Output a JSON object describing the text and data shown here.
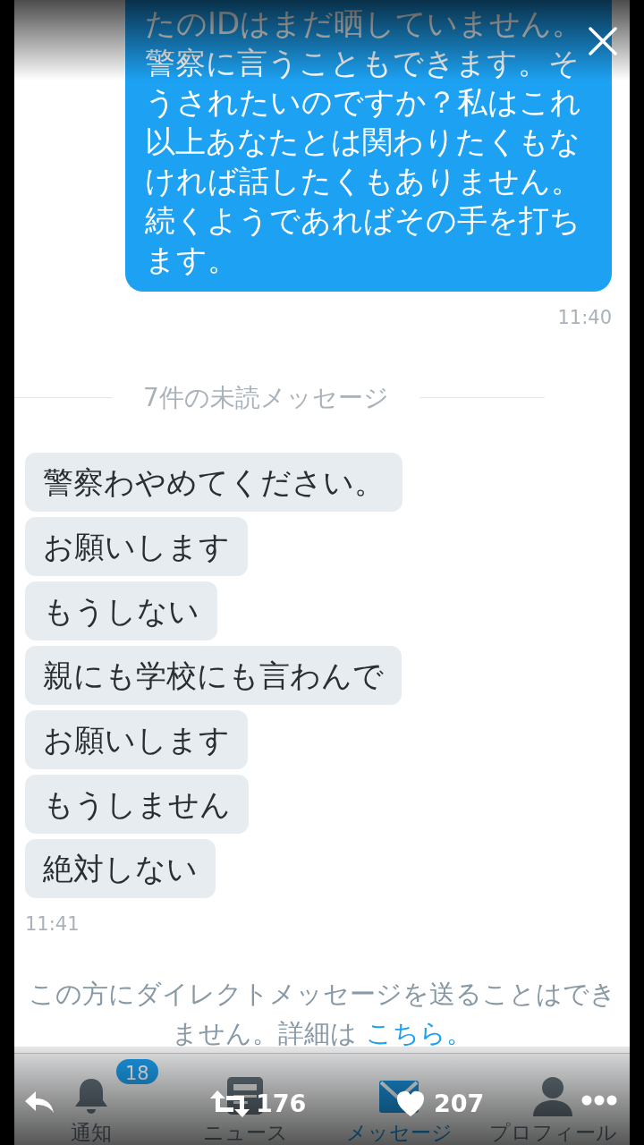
{
  "sent_message": {
    "text": "たのIDはまだ晒していません。警察に言うこともできます。そうされたいのですか？私はこれ以上あなたとは関わりたくもなければ話したくもありません。続くようであればその手を打ちます。",
    "time": "11:40"
  },
  "unread_divider": "7件の未読メッセージ",
  "received_messages": [
    {
      "text": "警察わやめてください。"
    },
    {
      "text": "お願いします"
    },
    {
      "text": "もうしない"
    },
    {
      "text": "親にも学校にも言わんで"
    },
    {
      "text": "お願いします"
    },
    {
      "text": "もうしません"
    },
    {
      "text": "絶対しない"
    }
  ],
  "received_time": "11:41",
  "notice": {
    "text": "この方にダイレクトメッセージを送ることはできません。詳細は",
    "link": "こちら。"
  },
  "tab_bar": [
    {
      "kind": "bell",
      "label": "通知",
      "badge": "18",
      "selected": false
    },
    {
      "kind": "news",
      "label": "ニュース",
      "selected": false
    },
    {
      "kind": "mail",
      "label": "メッセージ",
      "selected": true
    },
    {
      "kind": "person",
      "label": "プロフィール",
      "selected": false
    }
  ],
  "actions": {
    "retweets": "176",
    "likes": "207"
  }
}
